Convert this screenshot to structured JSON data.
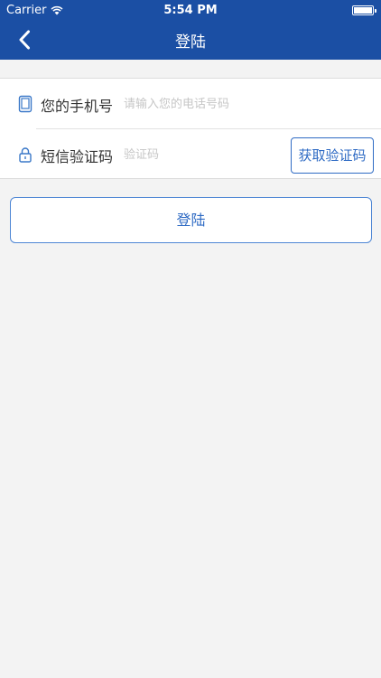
{
  "status_bar": {
    "carrier": "Carrier",
    "time": "5:54 PM",
    "battery_level": 1.0
  },
  "nav": {
    "title": "登陆",
    "back_icon": "chevron-left-icon"
  },
  "form": {
    "phone": {
      "icon": "phone-icon",
      "label": "您的手机号",
      "placeholder": "请输入您的电话号码",
      "value": ""
    },
    "code": {
      "icon": "lock-icon",
      "label": "短信验证码",
      "placeholder": "验证码",
      "value": "",
      "button_label": "获取验证码"
    }
  },
  "login_button": {
    "label": "登陆"
  },
  "colors": {
    "nav_background": "#1b4fa4",
    "accent": "#2f6bc4",
    "page_background": "#f3f3f3"
  }
}
